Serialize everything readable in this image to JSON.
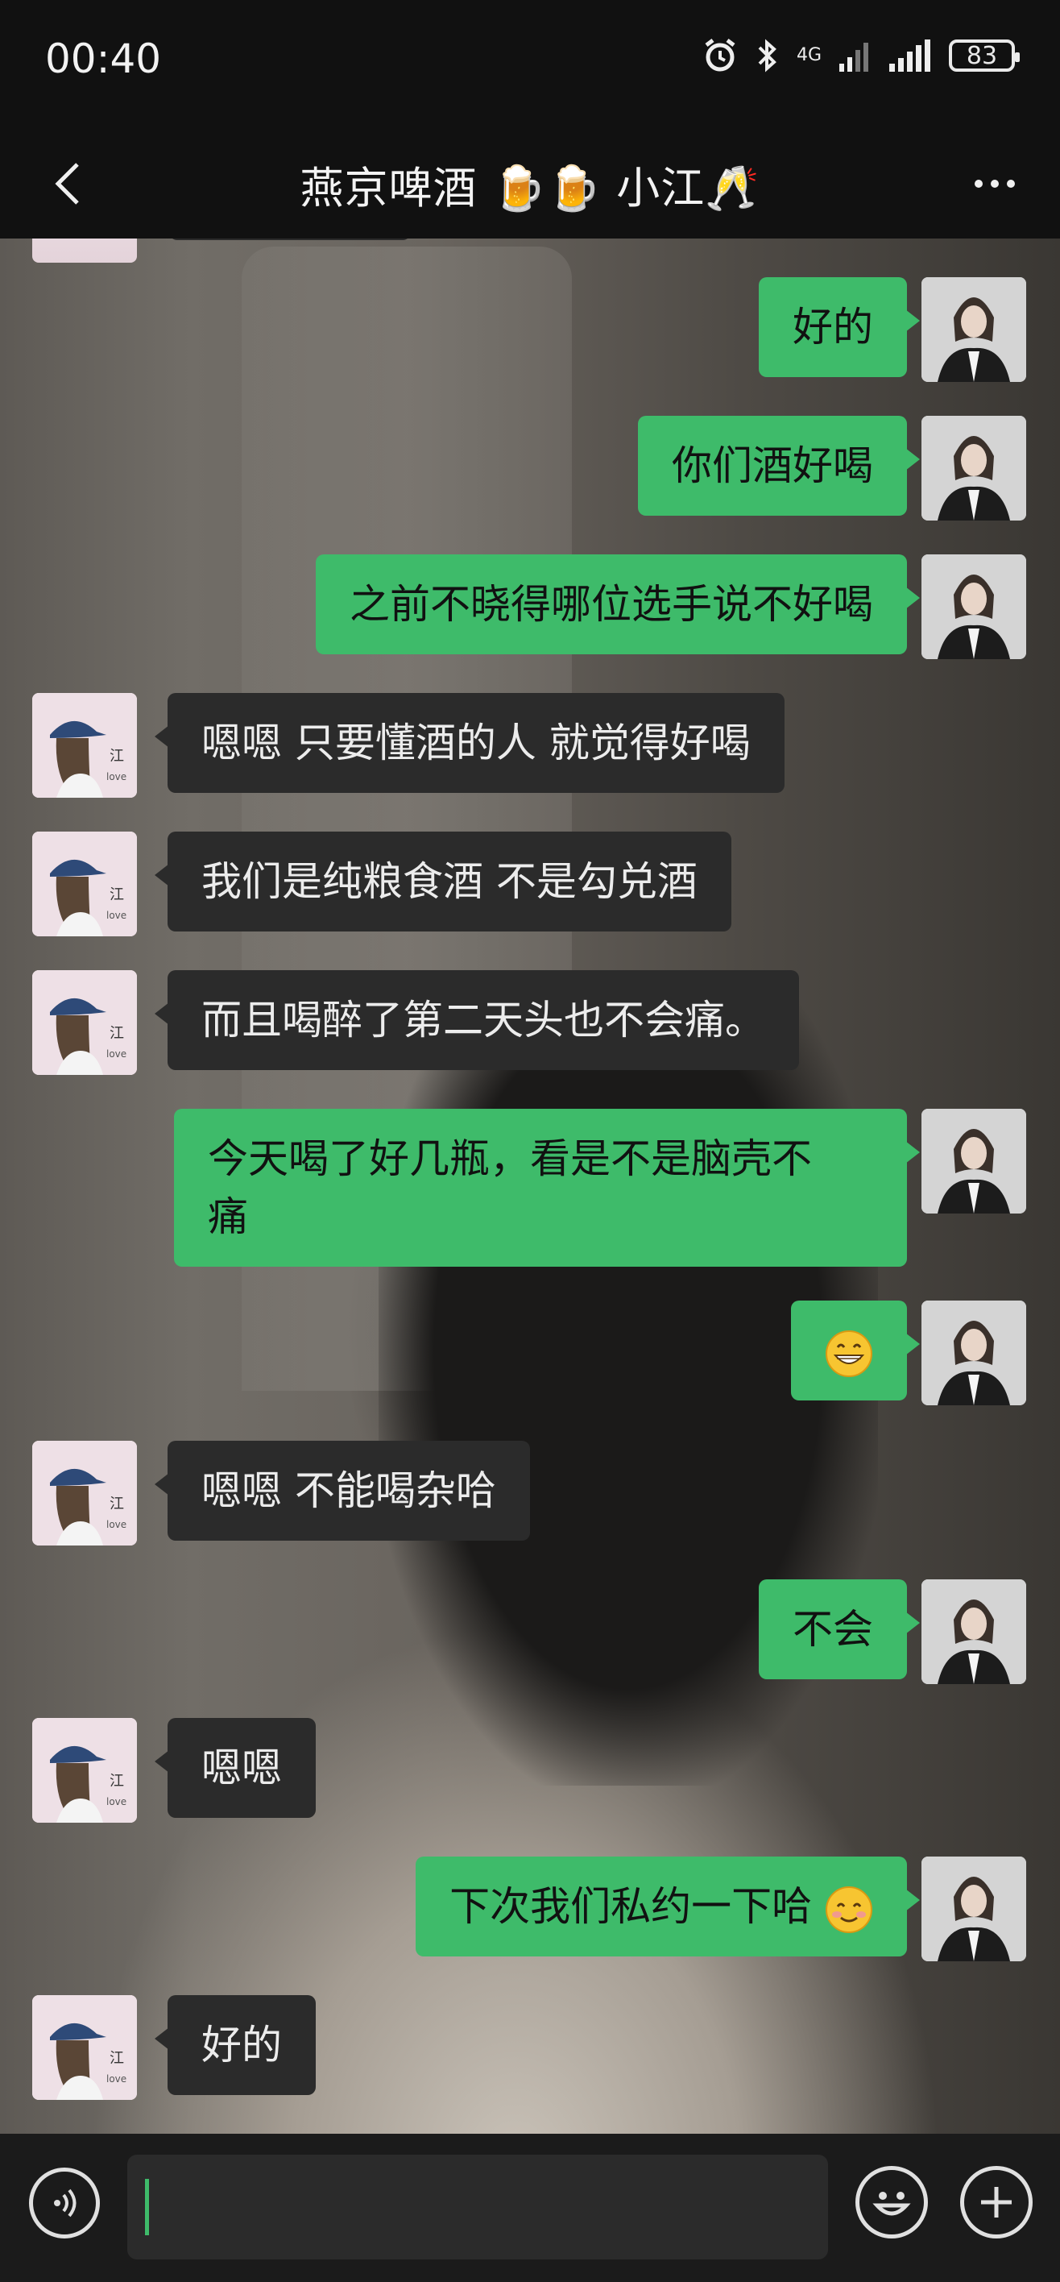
{
  "status_bar": {
    "time": "00:40",
    "battery": "83",
    "network": "4G"
  },
  "header": {
    "title": "燕京啤酒 🍺🍺 小江🥂"
  },
  "messages": [
    {
      "side": "me",
      "text": "好的"
    },
    {
      "side": "me",
      "text": "你们酒好喝"
    },
    {
      "side": "me",
      "text": "之前不晓得哪位选手说不好喝"
    },
    {
      "side": "them",
      "text": "嗯嗯 只要懂酒的人 就觉得好喝"
    },
    {
      "side": "them",
      "text": "我们是纯粮食酒 不是勾兑酒"
    },
    {
      "side": "them",
      "text": "而且喝醉了第二天头也不会痛。"
    },
    {
      "side": "me",
      "text_line1": "今天喝了好几瓶，看是不是脑壳不",
      "text_line2": "痛"
    },
    {
      "side": "me",
      "emoji": "grinning-face"
    },
    {
      "side": "them",
      "text": "嗯嗯 不能喝杂哈"
    },
    {
      "side": "me",
      "text": "不会"
    },
    {
      "side": "them",
      "text": "嗯嗯"
    },
    {
      "side": "me",
      "text": "下次我们私约一下哈",
      "emoji": "smiling-face"
    },
    {
      "side": "them",
      "text": "好的"
    }
  ],
  "avatar_them": {
    "caption": "江",
    "caption2": "love"
  },
  "colors": {
    "me_bubble": "#3ebb6a",
    "them_bubble": "#2b2b2b",
    "header_bg": "#111111"
  }
}
